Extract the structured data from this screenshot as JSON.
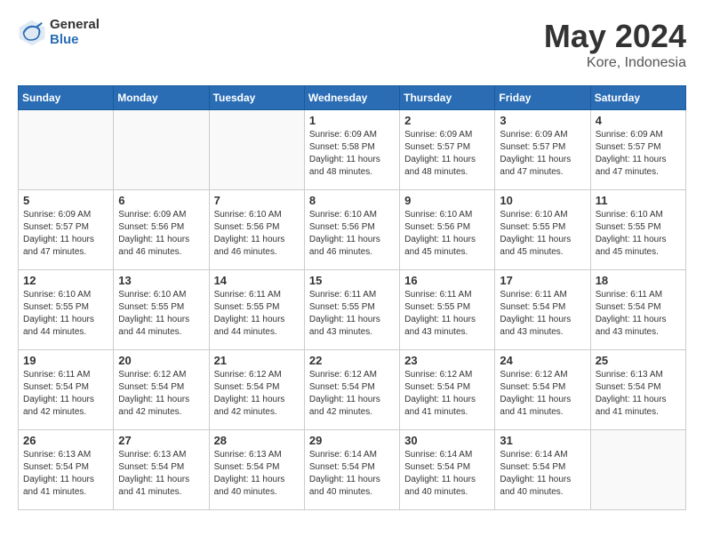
{
  "header": {
    "logo_general": "General",
    "logo_blue": "Blue",
    "title": "May 2024",
    "location": "Kore, Indonesia"
  },
  "days_of_week": [
    "Sunday",
    "Monday",
    "Tuesday",
    "Wednesday",
    "Thursday",
    "Friday",
    "Saturday"
  ],
  "weeks": [
    [
      {
        "day": "",
        "info": ""
      },
      {
        "day": "",
        "info": ""
      },
      {
        "day": "",
        "info": ""
      },
      {
        "day": "1",
        "info": "Sunrise: 6:09 AM\nSunset: 5:58 PM\nDaylight: 11 hours\nand 48 minutes."
      },
      {
        "day": "2",
        "info": "Sunrise: 6:09 AM\nSunset: 5:57 PM\nDaylight: 11 hours\nand 48 minutes."
      },
      {
        "day": "3",
        "info": "Sunrise: 6:09 AM\nSunset: 5:57 PM\nDaylight: 11 hours\nand 47 minutes."
      },
      {
        "day": "4",
        "info": "Sunrise: 6:09 AM\nSunset: 5:57 PM\nDaylight: 11 hours\nand 47 minutes."
      }
    ],
    [
      {
        "day": "5",
        "info": "Sunrise: 6:09 AM\nSunset: 5:57 PM\nDaylight: 11 hours\nand 47 minutes."
      },
      {
        "day": "6",
        "info": "Sunrise: 6:09 AM\nSunset: 5:56 PM\nDaylight: 11 hours\nand 46 minutes."
      },
      {
        "day": "7",
        "info": "Sunrise: 6:10 AM\nSunset: 5:56 PM\nDaylight: 11 hours\nand 46 minutes."
      },
      {
        "day": "8",
        "info": "Sunrise: 6:10 AM\nSunset: 5:56 PM\nDaylight: 11 hours\nand 46 minutes."
      },
      {
        "day": "9",
        "info": "Sunrise: 6:10 AM\nSunset: 5:56 PM\nDaylight: 11 hours\nand 45 minutes."
      },
      {
        "day": "10",
        "info": "Sunrise: 6:10 AM\nSunset: 5:55 PM\nDaylight: 11 hours\nand 45 minutes."
      },
      {
        "day": "11",
        "info": "Sunrise: 6:10 AM\nSunset: 5:55 PM\nDaylight: 11 hours\nand 45 minutes."
      }
    ],
    [
      {
        "day": "12",
        "info": "Sunrise: 6:10 AM\nSunset: 5:55 PM\nDaylight: 11 hours\nand 44 minutes."
      },
      {
        "day": "13",
        "info": "Sunrise: 6:10 AM\nSunset: 5:55 PM\nDaylight: 11 hours\nand 44 minutes."
      },
      {
        "day": "14",
        "info": "Sunrise: 6:11 AM\nSunset: 5:55 PM\nDaylight: 11 hours\nand 44 minutes."
      },
      {
        "day": "15",
        "info": "Sunrise: 6:11 AM\nSunset: 5:55 PM\nDaylight: 11 hours\nand 43 minutes."
      },
      {
        "day": "16",
        "info": "Sunrise: 6:11 AM\nSunset: 5:55 PM\nDaylight: 11 hours\nand 43 minutes."
      },
      {
        "day": "17",
        "info": "Sunrise: 6:11 AM\nSunset: 5:54 PM\nDaylight: 11 hours\nand 43 minutes."
      },
      {
        "day": "18",
        "info": "Sunrise: 6:11 AM\nSunset: 5:54 PM\nDaylight: 11 hours\nand 43 minutes."
      }
    ],
    [
      {
        "day": "19",
        "info": "Sunrise: 6:11 AM\nSunset: 5:54 PM\nDaylight: 11 hours\nand 42 minutes."
      },
      {
        "day": "20",
        "info": "Sunrise: 6:12 AM\nSunset: 5:54 PM\nDaylight: 11 hours\nand 42 minutes."
      },
      {
        "day": "21",
        "info": "Sunrise: 6:12 AM\nSunset: 5:54 PM\nDaylight: 11 hours\nand 42 minutes."
      },
      {
        "day": "22",
        "info": "Sunrise: 6:12 AM\nSunset: 5:54 PM\nDaylight: 11 hours\nand 42 minutes."
      },
      {
        "day": "23",
        "info": "Sunrise: 6:12 AM\nSunset: 5:54 PM\nDaylight: 11 hours\nand 41 minutes."
      },
      {
        "day": "24",
        "info": "Sunrise: 6:12 AM\nSunset: 5:54 PM\nDaylight: 11 hours\nand 41 minutes."
      },
      {
        "day": "25",
        "info": "Sunrise: 6:13 AM\nSunset: 5:54 PM\nDaylight: 11 hours\nand 41 minutes."
      }
    ],
    [
      {
        "day": "26",
        "info": "Sunrise: 6:13 AM\nSunset: 5:54 PM\nDaylight: 11 hours\nand 41 minutes."
      },
      {
        "day": "27",
        "info": "Sunrise: 6:13 AM\nSunset: 5:54 PM\nDaylight: 11 hours\nand 41 minutes."
      },
      {
        "day": "28",
        "info": "Sunrise: 6:13 AM\nSunset: 5:54 PM\nDaylight: 11 hours\nand 40 minutes."
      },
      {
        "day": "29",
        "info": "Sunrise: 6:14 AM\nSunset: 5:54 PM\nDaylight: 11 hours\nand 40 minutes."
      },
      {
        "day": "30",
        "info": "Sunrise: 6:14 AM\nSunset: 5:54 PM\nDaylight: 11 hours\nand 40 minutes."
      },
      {
        "day": "31",
        "info": "Sunrise: 6:14 AM\nSunset: 5:54 PM\nDaylight: 11 hours\nand 40 minutes."
      },
      {
        "day": "",
        "info": ""
      }
    ]
  ]
}
